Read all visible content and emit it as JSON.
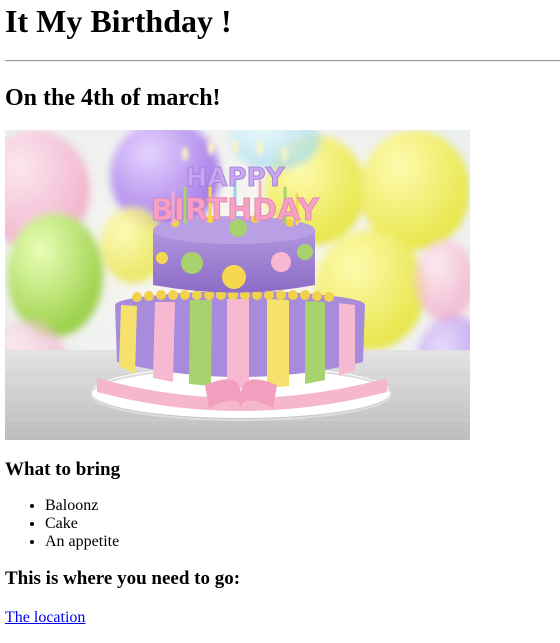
{
  "page": {
    "title": "It My Birthday !",
    "date_heading": "On the 4th of march!",
    "image": {
      "name": "birthday-cake-image",
      "topper_line1": "HAPPY",
      "topper_line2": "BIRTHDAY"
    },
    "bring_heading": "What to bring",
    "bring_items": [
      "Baloonz",
      "Cake",
      "An appetite"
    ],
    "go_heading": "This is where you need to go:",
    "location_link": "The location"
  },
  "colors": {
    "link": "#0000ee",
    "cake_purple": "#9b7fd0",
    "cake_pink": "#f2b8cf",
    "cake_yellow": "#f0d24a",
    "cake_green": "#a7cf6a"
  }
}
